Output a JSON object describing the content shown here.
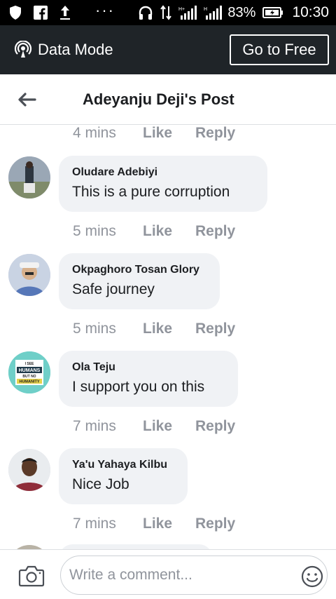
{
  "status_bar": {
    "icons_left": [
      "shield-icon",
      "facebook-icon",
      "upload-icon"
    ],
    "more": "···",
    "battery_percent": "83%",
    "time": "10:30"
  },
  "data_bar": {
    "label": "Data Mode",
    "button": "Go to Free"
  },
  "header": {
    "title": "Adeyanju Deji's Post"
  },
  "top_meta": {
    "time": "4 mins",
    "like": "Like",
    "reply": "Reply"
  },
  "comments": [
    {
      "name": "Oludare Adebiyi",
      "text": "This is a pure corruption",
      "time": "5 mins",
      "like": "Like",
      "reply": "Reply"
    },
    {
      "name": "Okpaghoro Tosan Glory",
      "text": "Safe journey",
      "time": "5 mins",
      "like": "Like",
      "reply": "Reply"
    },
    {
      "name": "Ola Teju",
      "text": "I support you on this",
      "time": "7 mins",
      "like": "Like",
      "reply": "Reply",
      "avatar_text": [
        "I SEE",
        "HUMANS",
        "BUT NO",
        "HUMANITY"
      ]
    },
    {
      "name": "Ya'u Yahaya Kilbu",
      "text": "Nice Job",
      "time": "7 mins",
      "like": "Like",
      "reply": "Reply"
    }
  ],
  "composer": {
    "placeholder": "Write a comment..."
  },
  "colors": {
    "data_bar_bg": "#1f2428",
    "bubble_bg": "#f0f2f5",
    "meta_text": "#90949c"
  }
}
